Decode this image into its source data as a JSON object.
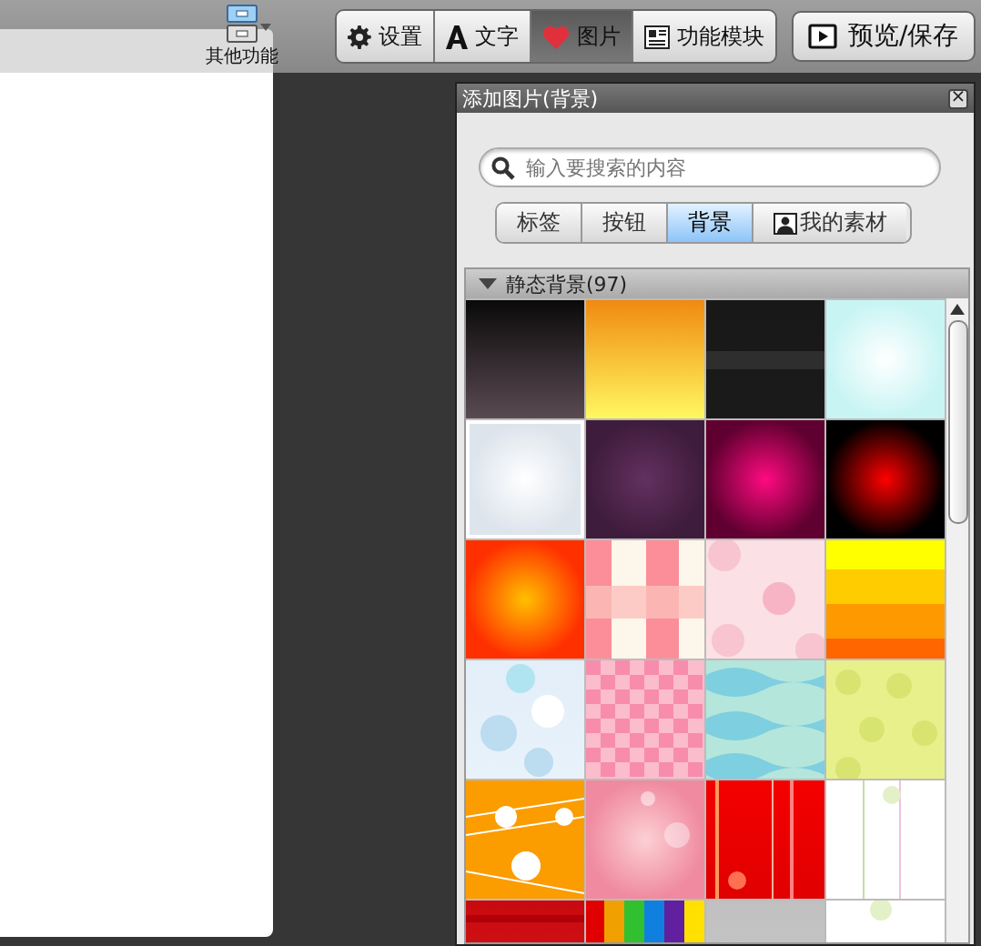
{
  "toolbar": {
    "other": {
      "label": "其他功能"
    },
    "tabs": [
      {
        "label": "设置",
        "kind": "gear",
        "selected": false
      },
      {
        "label": "文字",
        "kind": "letter",
        "selected": false
      },
      {
        "label": "图片",
        "kind": "heart",
        "selected": true
      },
      {
        "label": "功能模块",
        "kind": "module",
        "selected": false
      }
    ],
    "preview_button": "预览/保存"
  },
  "dialog": {
    "title": "添加图片(背景)",
    "close": "×",
    "search": {
      "placeholder": "输入要搜索的内容"
    },
    "tabs": [
      {
        "label": "标签",
        "selected": false,
        "icon": false
      },
      {
        "label": "按钮",
        "selected": false,
        "icon": false
      },
      {
        "label": "背景",
        "selected": true,
        "icon": false
      },
      {
        "label": "我的素材",
        "selected": false,
        "icon": true
      }
    ],
    "section": {
      "title": "静态背景(97)",
      "expanded": true
    }
  }
}
